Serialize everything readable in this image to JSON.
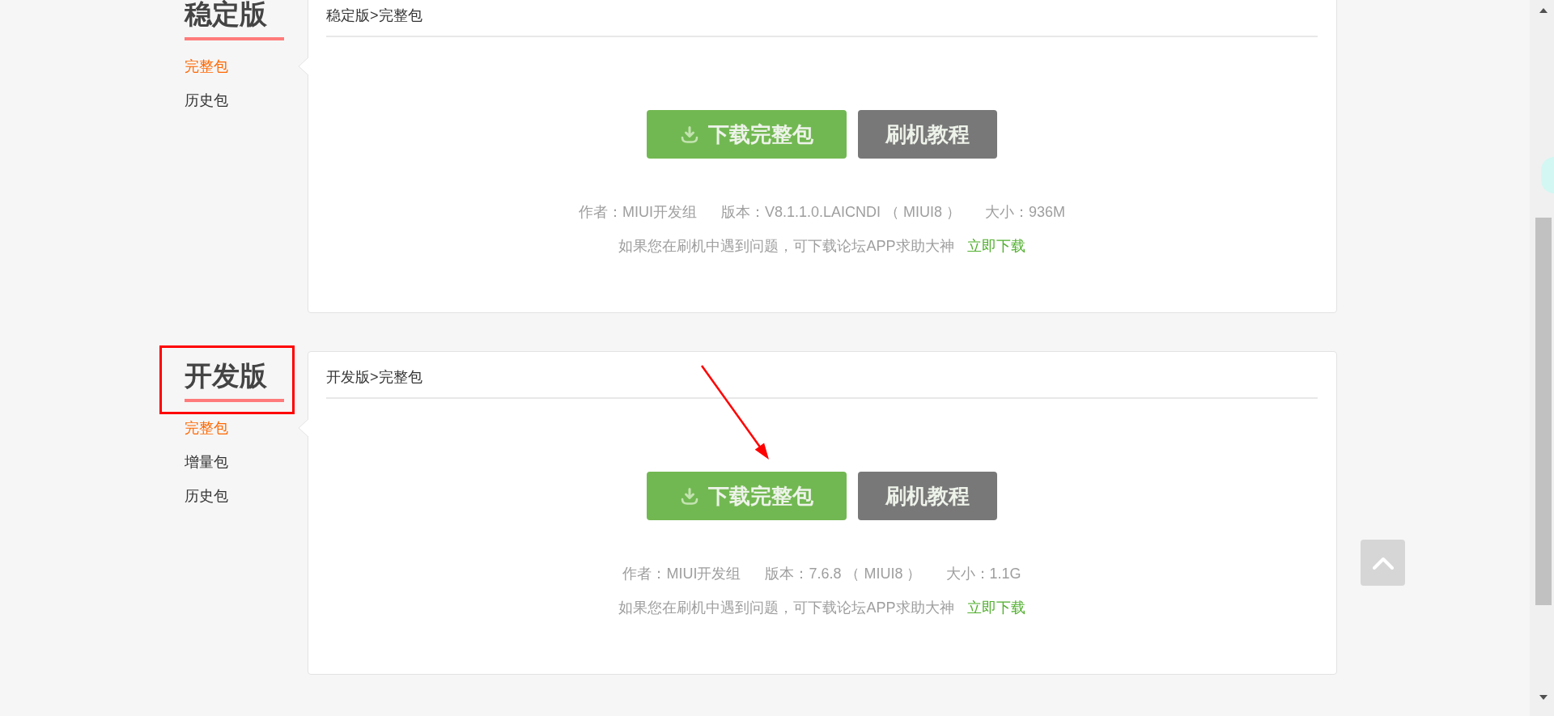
{
  "sections": [
    {
      "title": "稳定版",
      "annotation_box": false,
      "annotation_arrow": false,
      "menu": [
        {
          "label": "完整包",
          "selected": true
        },
        {
          "label": "历史包",
          "selected": false
        }
      ],
      "breadcrumb": "稳定版>完整包",
      "buttons": [
        {
          "kind": "download",
          "label": "下载完整包"
        },
        {
          "kind": "tutorial",
          "label": "刷机教程"
        }
      ],
      "info": [
        "作者：MIUI开发组",
        "版本：V8.1.1.0.LAICNDI （ MIUI8 ）",
        "大小：936M"
      ],
      "help": {
        "text": "如果您在刷机中遇到问题，可下载论坛APP求助大神",
        "link": "立即下载"
      }
    },
    {
      "title": "开发版",
      "annotation_box": true,
      "annotation_arrow": true,
      "menu": [
        {
          "label": "完整包",
          "selected": true
        },
        {
          "label": "增量包",
          "selected": false
        },
        {
          "label": "历史包",
          "selected": false
        }
      ],
      "breadcrumb": "开发版>完整包",
      "buttons": [
        {
          "kind": "download",
          "label": "下载完整包"
        },
        {
          "kind": "tutorial",
          "label": "刷机教程"
        }
      ],
      "info": [
        "作者：MIUI开发组",
        "版本：7.6.8 （ MIUI8 ）",
        "大小：1.1G"
      ],
      "help": {
        "text": "如果您在刷机中遇到问题，可下载论坛APP求助大神",
        "link": "立即下载"
      }
    }
  ]
}
